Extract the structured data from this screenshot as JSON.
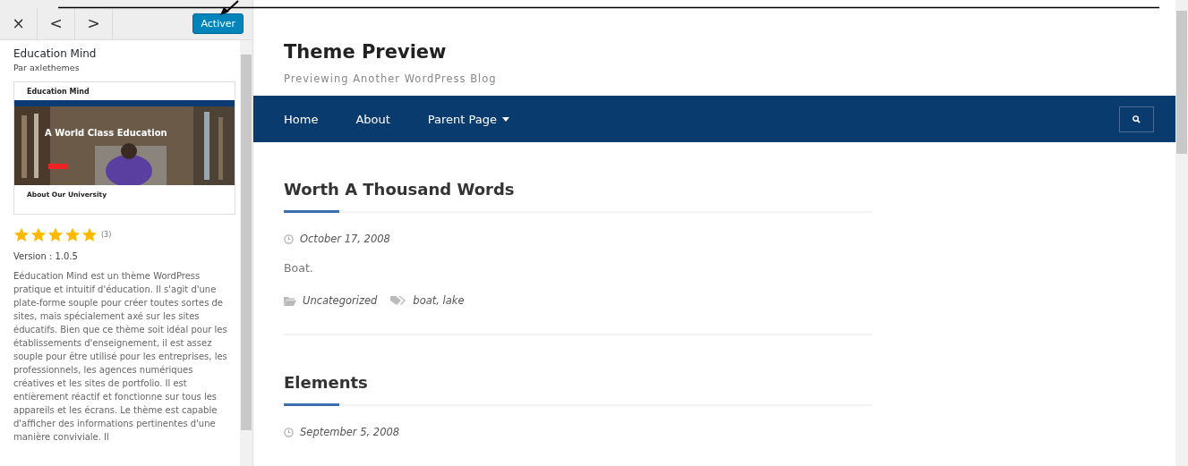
{
  "toolbar": {
    "close": "×",
    "previous": "<",
    "next": ">",
    "activate": "Activer"
  },
  "theme": {
    "name": "Education Mind",
    "author": "Par axlethemes",
    "screenshot": {
      "site_title": "Education Mind",
      "hero_title": "A World Class Education",
      "section_title": "About Our University"
    },
    "stars": 5,
    "rating_count": "(3)",
    "version": "Version : 1.0.5",
    "description": "Eéducation Mind est un thème WordPress pratique et intuitif d'éducation. Il s'agit d'une plate-forme souple pour créer toutes sortes de sites, mais spécialement axé sur les sites éducatifs. Bien que ce thème soit idéal pour les établissements d'enseignement, il est assez souple pour être utilisé pour les entreprises, les professionnels, les agences numériques créatives et les sites de portfolio. Il est entièrement réactif et fonctionne sur tous les appareils et les écrans. Le thème est capable d'afficher des informations pertinentes d'une manière conviviale. Il"
  },
  "preview": {
    "site_title": "Theme Preview",
    "tagline": "Previewing Another WordPress Blog",
    "menu": [
      {
        "label": "Home",
        "dropdown": false
      },
      {
        "label": "About",
        "dropdown": false
      },
      {
        "label": "Parent Page",
        "dropdown": true
      }
    ],
    "posts": [
      {
        "title": "Worth A Thousand Words",
        "date": "October 17, 2008",
        "excerpt": "Boat.",
        "category": "Uncategorized",
        "tags": "boat, lake"
      },
      {
        "title": "Elements",
        "date": "September 5, 2008"
      }
    ]
  }
}
